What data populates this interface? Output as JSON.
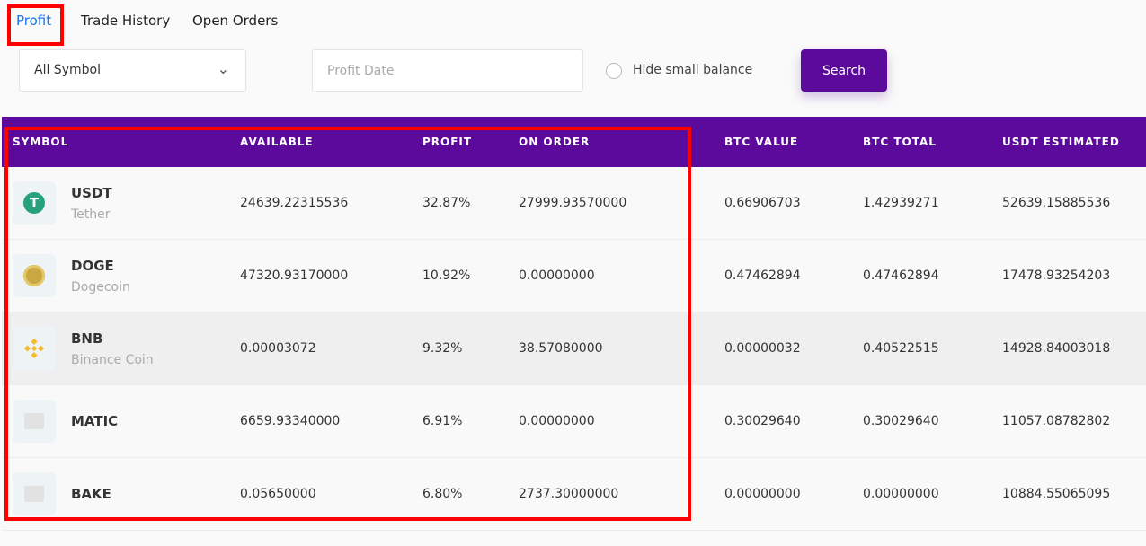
{
  "tabs": [
    {
      "label": "Profit"
    },
    {
      "label": "Trade History"
    },
    {
      "label": "Open Orders"
    }
  ],
  "filters": {
    "symbol_select": "All Symbol",
    "date_placeholder": "Profit Date",
    "hide_small_label": "Hide small balance",
    "search_label": "Search"
  },
  "table": {
    "headers": [
      "SYMBOL",
      "AVAILABLE",
      "PROFIT",
      "ON ORDER",
      "BTC VALUE",
      "BTC TOTAL",
      "USDT ESTIMATED"
    ],
    "rows": [
      {
        "symbol": "USDT",
        "name": "Tether",
        "icon": "tether-icon",
        "available": "24639.22315536",
        "profit": "32.87%",
        "on_order": "27999.93570000",
        "btc_value": "0.66906703",
        "btc_total": "1.42939271",
        "usdt_est": "52639.15885536"
      },
      {
        "symbol": "DOGE",
        "name": "Dogecoin",
        "icon": "dogecoin-icon",
        "available": "47320.93170000",
        "profit": "10.92%",
        "on_order": "0.00000000",
        "btc_value": "0.47462894",
        "btc_total": "0.47462894",
        "usdt_est": "17478.93254203"
      },
      {
        "symbol": "BNB",
        "name": "Binance Coin",
        "icon": "binance-coin-icon",
        "available": "0.00003072",
        "profit": "9.32%",
        "on_order": "38.57080000",
        "btc_value": "0.00000032",
        "btc_total": "0.40522515",
        "usdt_est": "14928.84003018"
      },
      {
        "symbol": "MATIC",
        "name": "",
        "icon": "placeholder-image-icon",
        "available": "6659.93340000",
        "profit": "6.91%",
        "on_order": "0.00000000",
        "btc_value": "0.30029640",
        "btc_total": "0.30029640",
        "usdt_est": "11057.08782802"
      },
      {
        "symbol": "BAKE",
        "name": "",
        "icon": "placeholder-image-icon",
        "available": "0.05650000",
        "profit": "6.80%",
        "on_order": "2737.30000000",
        "btc_value": "0.00000000",
        "btc_total": "0.00000000",
        "usdt_est": "10884.55065095"
      }
    ]
  },
  "colors": {
    "accent": "#5b0a9c",
    "active_tab": "#1a73e8",
    "annotation": "#ff0000"
  }
}
